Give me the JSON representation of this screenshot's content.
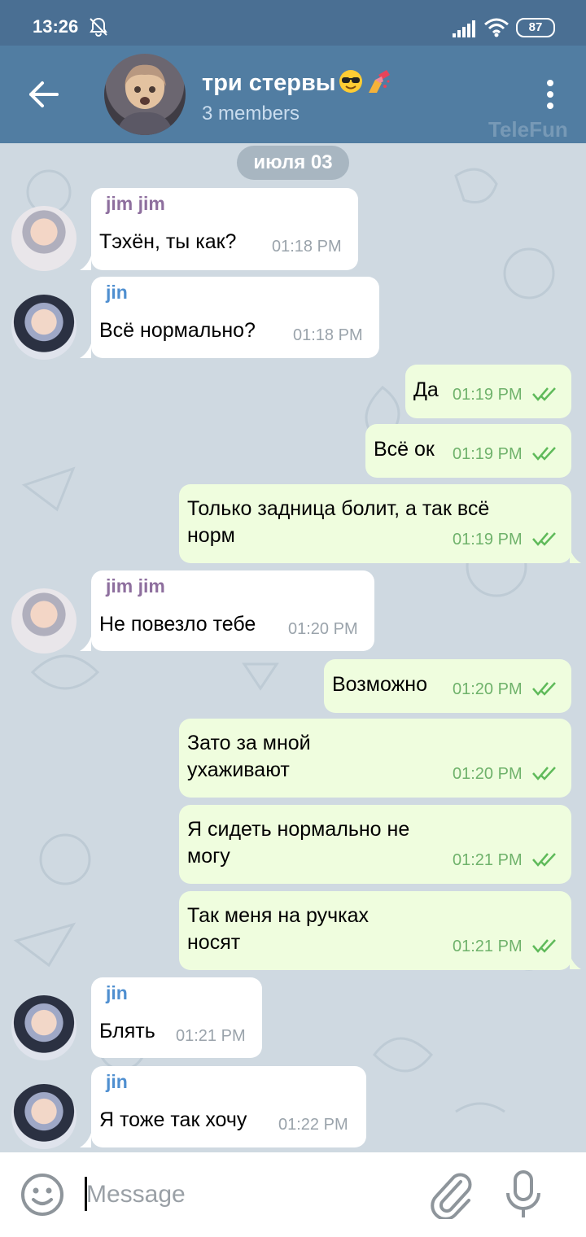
{
  "status_bar": {
    "time": "13:26",
    "battery": "87",
    "icons": [
      "bell-muted-icon",
      "signal-icon",
      "wifi-icon",
      "battery-icon"
    ]
  },
  "header": {
    "title": "три стервы",
    "title_emojis": [
      "sunglasses-emoji",
      "nail-polish-emoji"
    ],
    "subtitle": "3 members",
    "watermark": "TeleFun",
    "icons": [
      "back-arrow-icon",
      "more-vert-icon"
    ]
  },
  "date_divider": "июля 03",
  "colors": {
    "header": "#517da2",
    "status_bar": "#4a6f93",
    "wallpaper": "#cfd9e1",
    "outgoing_bubble": "#effdde",
    "incoming_bubble": "#ffffff",
    "sender_jim": "#8e6f9e",
    "sender_jin": "#4f8fd0",
    "checkmarks": "#5fba5a"
  },
  "messages": [
    {
      "direction": "in",
      "sender": "jim jim",
      "text": "Тэхён, ты как?",
      "time": "01:18 PM"
    },
    {
      "direction": "in",
      "sender": "jin",
      "text": "Всё нормально?",
      "time": "01:18 PM"
    },
    {
      "direction": "out",
      "text": "Да",
      "time": "01:19 PM",
      "status": "read"
    },
    {
      "direction": "out",
      "text": "Всё ок",
      "time": "01:19 PM",
      "status": "read"
    },
    {
      "direction": "out",
      "text_lines": [
        "Только задница болит, а так всё",
        "норм"
      ],
      "time": "01:19 PM",
      "status": "read"
    },
    {
      "direction": "in",
      "sender": "jim jim",
      "text": "Не повезло тебе",
      "time": "01:20 PM"
    },
    {
      "direction": "out",
      "text": "Возможно",
      "time": "01:20 PM",
      "status": "read"
    },
    {
      "direction": "out",
      "text_lines": [
        "Зато за мной",
        "ухаживают"
      ],
      "time": "01:20 PM",
      "status": "read"
    },
    {
      "direction": "out",
      "text_lines": [
        "Я сидеть нормально не",
        "могу"
      ],
      "time": "01:21 PM",
      "status": "read"
    },
    {
      "direction": "out",
      "text_lines": [
        "Так меня на ручках",
        "носят"
      ],
      "time": "01:21 PM",
      "status": "read"
    },
    {
      "direction": "in",
      "sender": "jin",
      "text": "Блять",
      "time": "01:21 PM"
    },
    {
      "direction": "in",
      "sender": "jin",
      "text": "Я тоже так хочу",
      "time": "01:22 PM"
    }
  ],
  "input": {
    "placeholder": "Message",
    "icons": [
      "emoji-icon",
      "attach-icon",
      "mic-icon"
    ]
  }
}
